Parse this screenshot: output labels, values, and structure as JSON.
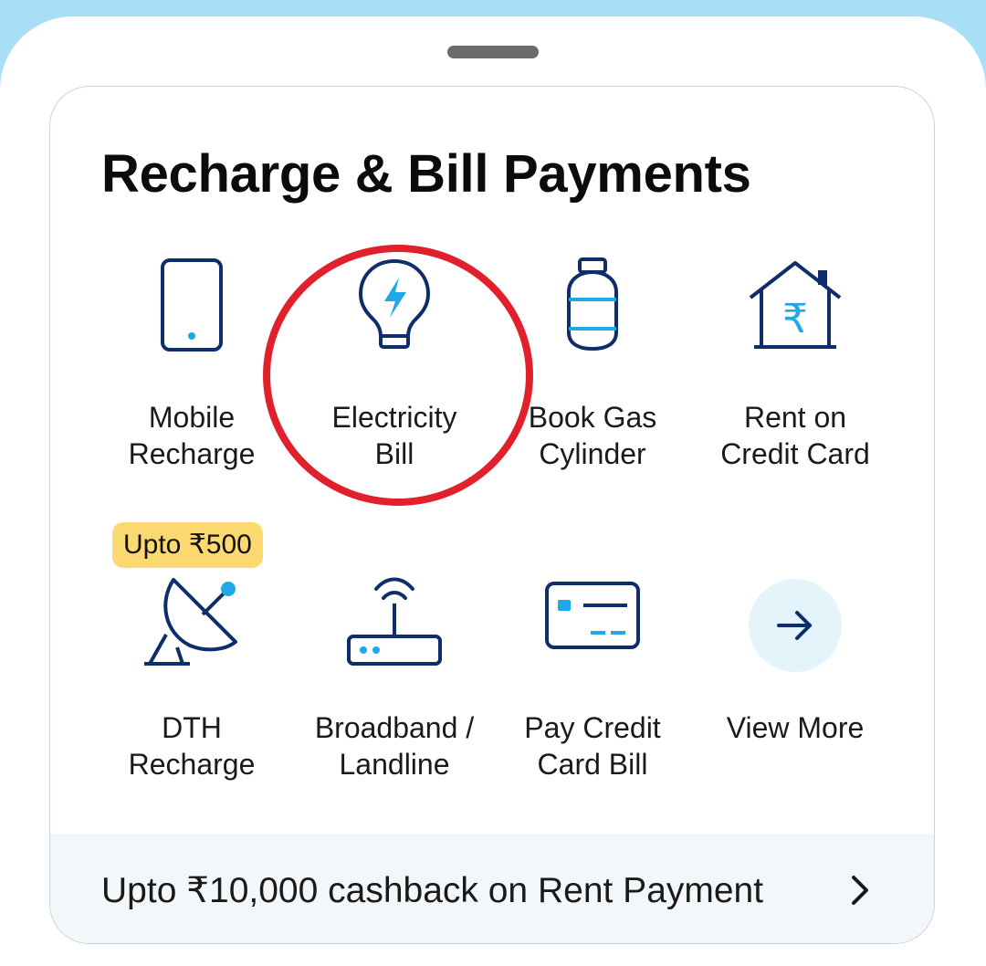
{
  "section": {
    "title": "Recharge & Bill Payments"
  },
  "tiles": [
    {
      "label_1": "Mobile",
      "label_2": "Recharge",
      "icon": "mobile-phone-icon"
    },
    {
      "label_1": "Electricity",
      "label_2": "Bill",
      "icon": "lightbulb-icon"
    },
    {
      "label_1": "Book Gas",
      "label_2": "Cylinder",
      "icon": "gas-cylinder-icon"
    },
    {
      "label_1": "Rent on",
      "label_2": "Credit Card",
      "icon": "house-rupee-icon"
    },
    {
      "label_1": "DTH",
      "label_2": "Recharge",
      "icon": "satellite-dish-icon",
      "badge": "Upto ₹500"
    },
    {
      "label_1": "Broadband /",
      "label_2": "Landline",
      "icon": "router-icon"
    },
    {
      "label_1": "Pay Credit",
      "label_2": "Card Bill",
      "icon": "credit-card-icon"
    },
    {
      "label_1": "View More",
      "label_2": "",
      "icon": "arrow-right-icon"
    }
  ],
  "footer": {
    "text": "Upto ₹10,000 cashback on Rent Payment",
    "icon": "chevron-right-icon"
  },
  "colors": {
    "icon_dark": "#0f2d6b",
    "icon_accent": "#1fa8e8",
    "badge": "#fbd970",
    "highlight_ring": "#e0202a",
    "header_bg": "#a9def7"
  }
}
